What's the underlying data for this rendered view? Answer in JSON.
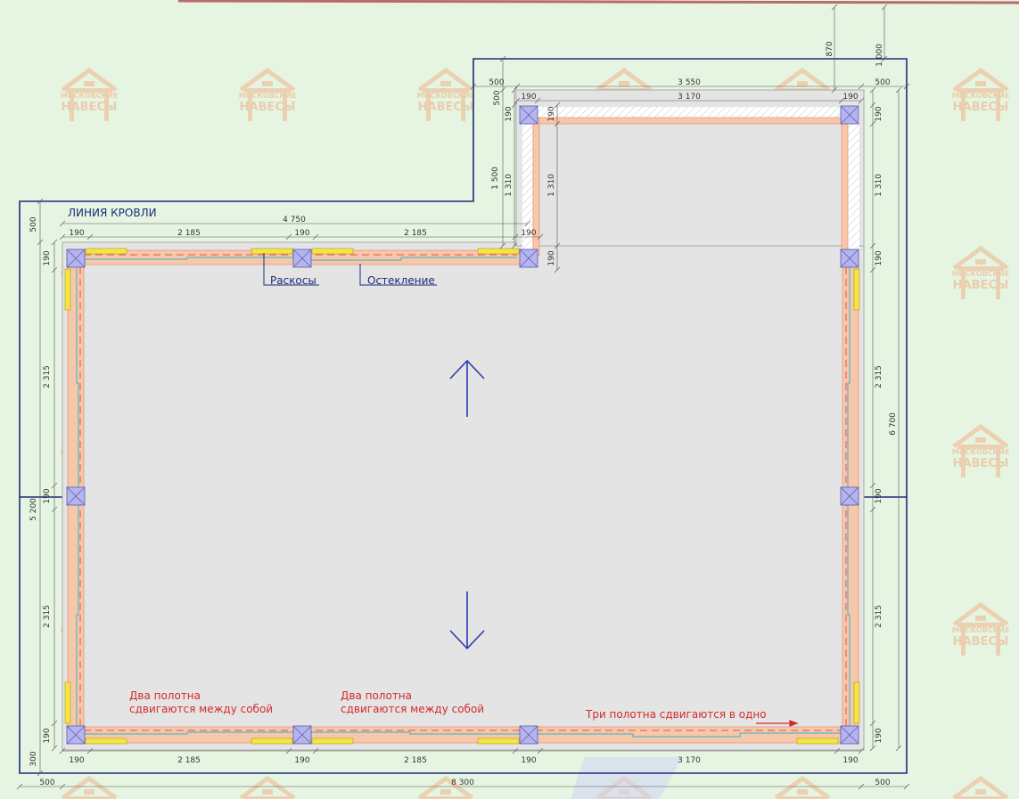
{
  "labels": {
    "roof_line": "ЛИНИЯ КРОВЛИ",
    "braces": "Раскосы",
    "glazing": "Остекление",
    "note_two_panels_1_line1": "Два полотна",
    "note_two_panels_1_line2": "сдвигаются между собой",
    "note_two_panels_2_line1": "Два полотна",
    "note_two_panels_2_line2": "сдвигаются между собой",
    "note_three_panels": "Три полотна сдвигаются в одно"
  },
  "watermark": {
    "line1": "МОСКОВСКИЕ",
    "line2": "НАВЕСЫ"
  },
  "dimensions": {
    "top_870": "870",
    "top_1000": "1 000",
    "top_500_left": "500",
    "top_3550": "3 550",
    "top_500_right": "500",
    "ext_190_a": "190",
    "ext_3170": "3 170",
    "ext_190_b": "190",
    "ext_500_v": "500",
    "ext_190_v": "190",
    "ext_1500_v": "1 500",
    "ext_1310_v_outer": "1 310",
    "ext_1310_v_inner": "1 310",
    "ext_190_v_inner": "190",
    "right_190_top": "190",
    "right_1310": "1 310",
    "right_190_mid": "190",
    "right_2315_top": "2 315",
    "right_6700": "6 700",
    "right_190_center": "190",
    "right_2315_bottom": "2 315",
    "right_190_bottom": "190",
    "main_4750": "4 750",
    "main_top_190_a": "190",
    "main_top_2185_a": "2 185",
    "main_top_190_b": "190",
    "main_top_2185_b": "2 185",
    "main_top_190_c": "190",
    "left_500": "500",
    "left_190_top": "190",
    "left_2315_top": "2 315",
    "left_5200": "5 200",
    "left_190_center": "190",
    "left_2315_bottom": "2 315",
    "left_190_bottom": "190",
    "left_300": "300",
    "ext_190_bottom_v": "190",
    "bot_190_a": "190",
    "bot_2185_a": "2 185",
    "bot_190_b": "190",
    "bot_2185_b": "2 185",
    "bot_190_c": "190",
    "bot_3170": "3 170",
    "bot_190_d": "190",
    "bot_500_left": "500",
    "bot_8300": "8 300",
    "bot_500_right": "500"
  },
  "colors": {
    "background": "#e6f5e2",
    "roof_line": "#1b2c7a",
    "floor": "#e5e5e5",
    "frame": "#f7c7a9",
    "post": "#b4b4ee",
    "glass": "#f5e542",
    "note_red": "#d42a2a"
  }
}
